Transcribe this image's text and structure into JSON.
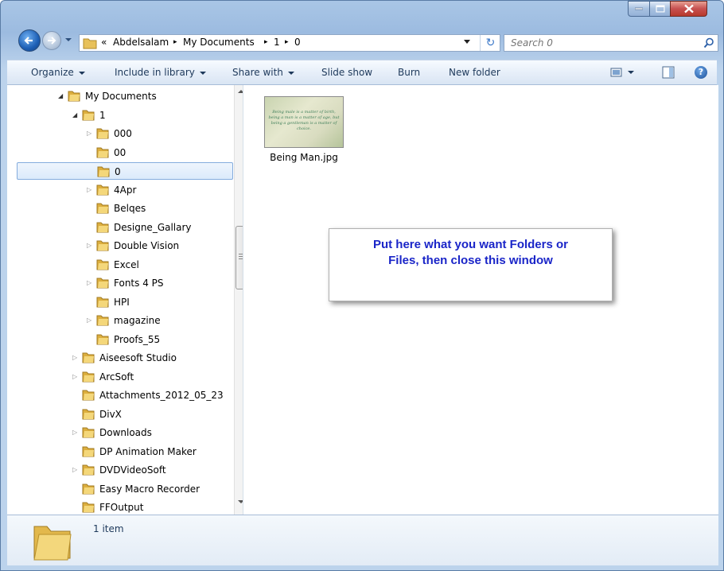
{
  "window": {
    "caption_buttons": {
      "minimize": "minimize-icon",
      "maximize": "maximize-icon",
      "close": "close-icon"
    }
  },
  "address_bar": {
    "overflow": "«",
    "crumbs": [
      "Abdelsalam",
      "My Documents",
      "1",
      "0"
    ],
    "separator": "▸",
    "refresh_glyph": "↻"
  },
  "search": {
    "placeholder": "Search 0"
  },
  "toolbar": {
    "organize": "Organize",
    "include_in_library": "Include in library",
    "share_with": "Share with",
    "slide_show": "Slide show",
    "burn": "Burn",
    "new_folder": "New folder",
    "help": "?"
  },
  "tree": [
    {
      "label": "My Documents",
      "level": 0,
      "expander": "open"
    },
    {
      "label": "1",
      "level": 1,
      "expander": "open"
    },
    {
      "label": "000",
      "level": 2,
      "expander": "closed"
    },
    {
      "label": "00",
      "level": 2,
      "expander": "none"
    },
    {
      "label": "0",
      "level": 2,
      "expander": "none",
      "selected": true
    },
    {
      "label": "4Apr",
      "level": 2,
      "expander": "closed"
    },
    {
      "label": "Belqes",
      "level": 2,
      "expander": "none"
    },
    {
      "label": "Designe_Gallary",
      "level": 2,
      "expander": "none"
    },
    {
      "label": "Double Vision",
      "level": 2,
      "expander": "closed"
    },
    {
      "label": "Excel",
      "level": 2,
      "expander": "none"
    },
    {
      "label": "Fonts 4 PS",
      "level": 2,
      "expander": "closed"
    },
    {
      "label": "HPI",
      "level": 2,
      "expander": "none"
    },
    {
      "label": "magazine",
      "level": 2,
      "expander": "closed"
    },
    {
      "label": "Proofs_55",
      "level": 2,
      "expander": "none"
    },
    {
      "label": "Aiseesoft Studio",
      "level": 1,
      "expander": "closed"
    },
    {
      "label": "ArcSoft",
      "level": 1,
      "expander": "closed"
    },
    {
      "label": "Attachments_2012_05_23",
      "level": 1,
      "expander": "none"
    },
    {
      "label": "DivX",
      "level": 1,
      "expander": "none"
    },
    {
      "label": "Downloads",
      "level": 1,
      "expander": "closed"
    },
    {
      "label": "DP Animation Maker",
      "level": 1,
      "expander": "none"
    },
    {
      "label": "DVDVideoSoft",
      "level": 1,
      "expander": "closed"
    },
    {
      "label": "Easy Macro Recorder",
      "level": 1,
      "expander": "none"
    },
    {
      "label": "FFOutput",
      "level": 1,
      "expander": "none"
    }
  ],
  "content": {
    "file": {
      "name": "Being Man.jpg",
      "thumb_text": "Being male is a matter of birth, being a man is a matter of age, but being a gentleman is a matter of choice."
    },
    "message": {
      "line1": "Put here what you want Folders or",
      "line2": "Files, then close this window"
    }
  },
  "details": {
    "count": "1 item"
  },
  "colors": {
    "message_text": "#1a25c8",
    "selection": "#dbeafb",
    "frame": "#a9c6e6"
  }
}
